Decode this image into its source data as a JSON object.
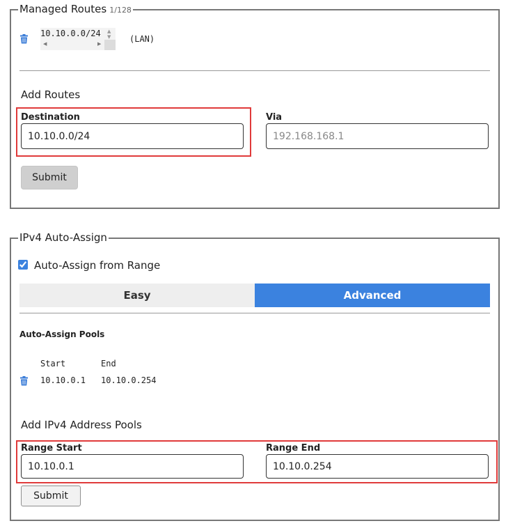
{
  "managed_routes": {
    "legend": "Managed Routes",
    "count": "1/128",
    "route_value": "10.10.0.0/24",
    "route_note": "(LAN)",
    "add_heading": "Add Routes",
    "destination_label": "Destination",
    "destination_value": "10.10.0.0/24",
    "via_label": "Via",
    "via_placeholder": "192.168.168.1",
    "submit_label": "Submit"
  },
  "auto_assign": {
    "legend": "IPv4 Auto-Assign",
    "checkbox_label": "Auto-Assign from Range",
    "checkbox_checked": true,
    "tab_easy": "Easy",
    "tab_advanced": "Advanced",
    "pools_heading": "Auto-Assign Pools",
    "col_start": "Start",
    "col_end": "End",
    "pool_start": "10.10.0.1",
    "pool_end": "10.10.0.254",
    "add_heading": "Add IPv4 Address Pools",
    "range_start_label": "Range Start",
    "range_start_value": "10.10.0.1",
    "range_end_label": "Range End",
    "range_end_value": "10.10.0.254",
    "submit_label": "Submit"
  },
  "colors": {
    "accent": "#3b82df",
    "highlight": "#e03a3a",
    "trash": "#3b7dd8"
  }
}
